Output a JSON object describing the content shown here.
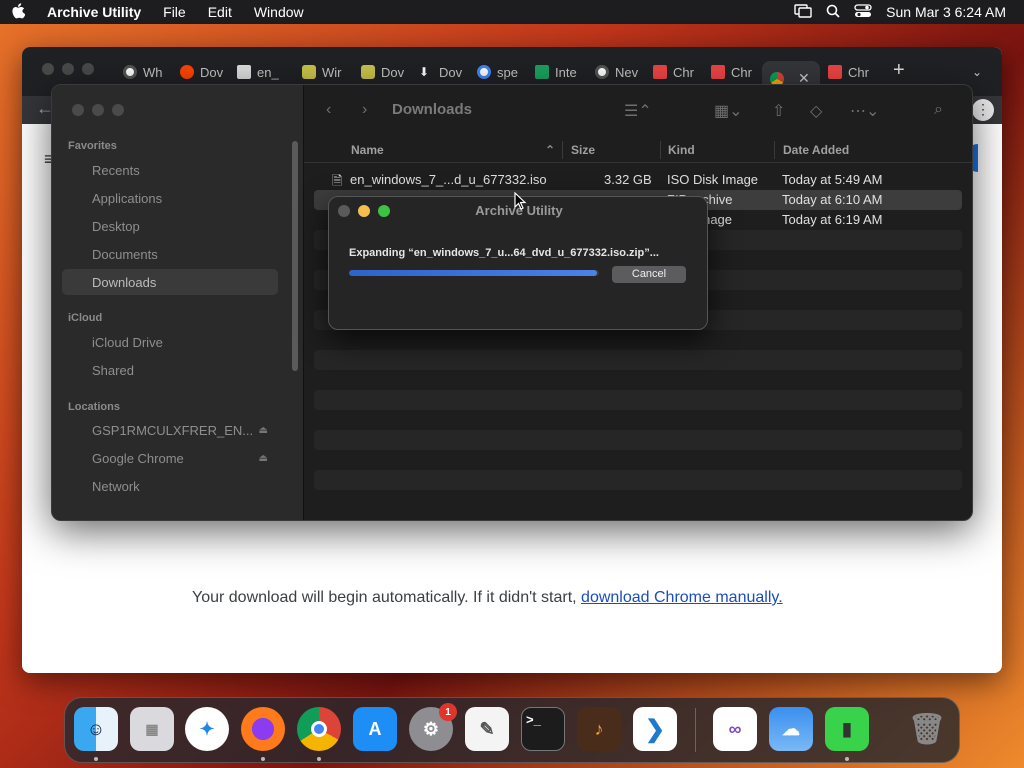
{
  "menubar": {
    "apple": "",
    "app": "Archive Utility",
    "items": [
      "File",
      "Edit",
      "Window"
    ],
    "datetime": "Sun Mar 3  6:24 AM"
  },
  "chrome": {
    "tabs": [
      "Wh",
      "Dov",
      "en_",
      "Wir",
      "Dov",
      "Dov",
      "spe",
      "Inte",
      "Nev",
      "Chr",
      "Chr",
      "",
      "Chr"
    ],
    "new_tab": "+",
    "page_text": "Your download will begin automatically. If it didn't start, ",
    "page_link": "download Chrome manually."
  },
  "finder": {
    "title": "Downloads",
    "sidebar": {
      "favorites_header": "Favorites",
      "favorites": [
        "Recents",
        "Applications",
        "Desktop",
        "Documents",
        "Downloads"
      ],
      "icloud_header": "iCloud",
      "icloud": [
        "iCloud Drive",
        "Shared"
      ],
      "locations_header": "Locations",
      "locations": [
        "GSP1RMCULXFRER_EN...",
        "Google Chrome",
        "Network"
      ]
    },
    "columns": {
      "name": "Name",
      "size": "Size",
      "kind": "Kind",
      "date": "Date Added"
    },
    "rows": [
      {
        "name": "en_windows_7_...d_u_677332.iso",
        "size": "3.32 GB",
        "kind": "ISO Disk Image",
        "date": "Today at 5:49 AM"
      },
      {
        "name": "",
        "size": "",
        "kind": "ZIP archive",
        "date": "Today at 6:10 AM"
      },
      {
        "name": "",
        "size": "",
        "kind": "Disk Image",
        "date": "Today at 6:19 AM"
      }
    ]
  },
  "dialog": {
    "title": "Archive Utility",
    "message": "Expanding “en_windows_7_u...64_dvd_u_677332.iso.zip”...",
    "progress": 0.99,
    "cancel": "Cancel"
  },
  "dock": {
    "apps": [
      "Finder",
      "Launchpad",
      "Safari",
      "Firefox",
      "Chrome",
      "App Store",
      "System Settings",
      "TextEdit",
      "Terminal",
      "GarageBand",
      "VS Code",
      "Visual Studio",
      "Weather",
      "Archive Utility",
      "Trash"
    ],
    "settings_badge": "1"
  },
  "colors": {
    "accent": "#2e63c8",
    "badge": "#e0352b"
  }
}
